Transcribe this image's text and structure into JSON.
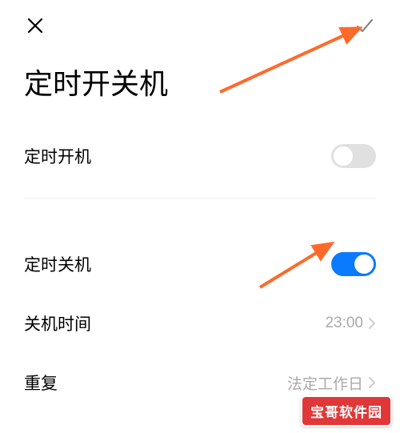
{
  "header": {
    "close_icon": "×",
    "confirm_icon": "✓"
  },
  "title": "定时开关机",
  "rows": {
    "power_on": {
      "label": "定时开机",
      "enabled": false
    },
    "power_off": {
      "label": "定时关机",
      "enabled": true
    },
    "shutdown_time": {
      "label": "关机时间",
      "value": "23:00"
    },
    "repeat": {
      "label": "重复",
      "value": "法定工作日"
    }
  },
  "watermark": "宝哥软件园"
}
